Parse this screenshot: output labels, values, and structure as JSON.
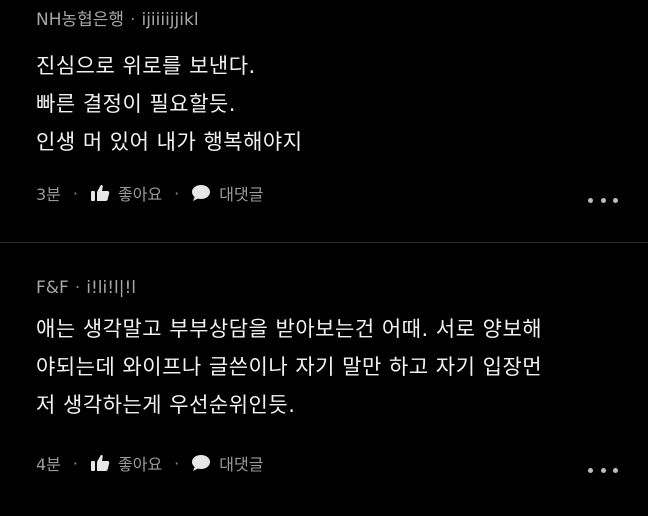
{
  "comments": [
    {
      "author": "NH농협은행",
      "tag": "ijiiiijjikl",
      "lines": [
        "진심으로 위로를 보낸다.",
        "빠른 결정이 필요할듯.",
        "인생 머 있어 내가 행복해야지"
      ],
      "time": "3분",
      "like_label": "좋아요",
      "reply_label": "대댓글"
    },
    {
      "author": "F&F",
      "tag": "i!li!l|!l",
      "lines": [
        "애는 생각말고 부부상담을 받아보는건 어때. 서로 양보해",
        "야되는데 와이프나 글쓴이나 자기 말만 하고 자기 입장먼",
        "저 생각하는게 우선순위인듯."
      ],
      "time": "4분",
      "like_label": "좋아요",
      "reply_label": "대댓글"
    }
  ],
  "separator": "·",
  "icons": {
    "like": "thumbs-up-icon",
    "reply": "speech-bubble-icon",
    "more": "more-dots-icon"
  },
  "colors": {
    "background": "#000000",
    "text": "#f2f2f2",
    "meta": "#9a9a9a"
  }
}
